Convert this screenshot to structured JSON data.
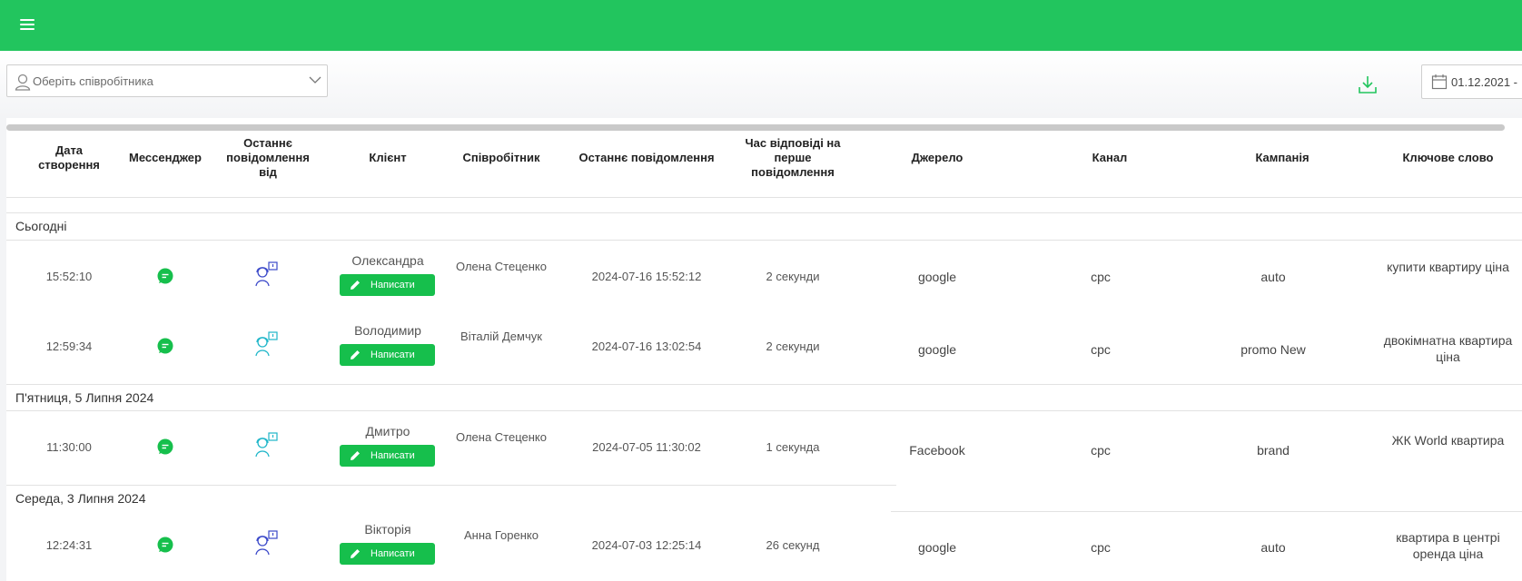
{
  "header": {
    "menu_icon": "hamburger-icon",
    "color": "#22c55e"
  },
  "toolbar": {
    "employee_placeholder": "Оберіть співробітника",
    "download_icon": "download-icon",
    "date_from": "01.12.2021  -"
  },
  "table": {
    "columns": [
      "Дата створення",
      "Мессенджер",
      "Останнє повідомлення від",
      "Клієнт",
      "Співробітник",
      "Останнє повідомлення",
      "Час відповіді на перше повідомлення",
      "Джерело",
      "Канал",
      "Кампанія",
      "Ключове слово"
    ],
    "write_label": "Написати",
    "groups": [
      {
        "label": "Сьогодні",
        "rows": [
          {
            "time": "15:52:10",
            "client": "Олександра",
            "employee": "Олена Стеценко",
            "last_message": "2024-07-16 15:52:12",
            "response": "2 секунди",
            "source": "google",
            "channel": "cpc",
            "campaign": "auto",
            "keyword": "купити квартиру ціна",
            "last_from": "operator"
          },
          {
            "time": "12:59:34",
            "client": "Володимир",
            "employee": "Віталій Демчук",
            "last_message": "2024-07-16 13:02:54",
            "response": "2 секунди",
            "source": "google",
            "channel": "cpc",
            "campaign": "promo New",
            "keyword": "двокімнатна квартира ціна",
            "last_from": "client"
          }
        ]
      },
      {
        "label": "П'ятниця, 5 Липня 2024",
        "rows": [
          {
            "time": "11:30:00",
            "client": "Дмитро",
            "employee": "Олена Стеценко",
            "last_message": "2024-07-05 11:30:02",
            "response": "1 секунда",
            "source": "Facebook",
            "channel": "cpc",
            "campaign": "brand",
            "keyword": "ЖК World квартира",
            "last_from": "client"
          }
        ]
      },
      {
        "label": "Середа, 3 Липня 2024",
        "rows": [
          {
            "time": "12:24:31",
            "client": "Вікторія",
            "employee": "Анна Горенко",
            "last_message": "2024-07-03 12:25:14",
            "response": "26 секунд",
            "source": "google",
            "channel": "cpc",
            "campaign": "auto",
            "keyword": "квартира в центрі оренда ціна",
            "last_from": "operator"
          }
        ]
      }
    ]
  }
}
